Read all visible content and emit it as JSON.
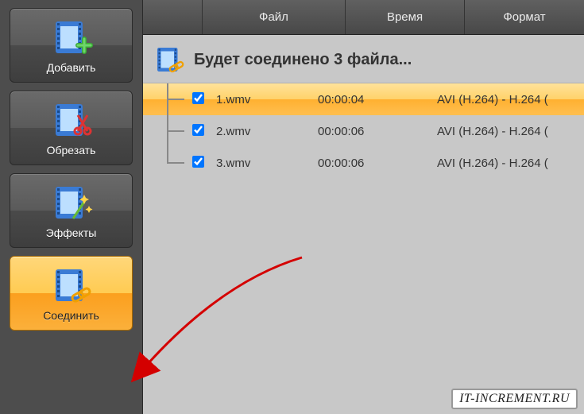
{
  "sidebar": {
    "items": [
      {
        "label": "Добавить"
      },
      {
        "label": "Обрезать"
      },
      {
        "label": "Эффекты"
      },
      {
        "label": "Соединить"
      }
    ]
  },
  "header": {
    "file": "Файл",
    "time": "Время",
    "format": "Формат"
  },
  "group": {
    "title": "Будет соединено 3 файла..."
  },
  "files": [
    {
      "name": "1.wmv",
      "time": "00:00:04",
      "format": "AVI (H.264) - H.264 (",
      "checked": true,
      "selected": true
    },
    {
      "name": "2.wmv",
      "time": "00:00:06",
      "format": "AVI (H.264) - H.264 (",
      "checked": true,
      "selected": false
    },
    {
      "name": "3.wmv",
      "time": "00:00:06",
      "format": "AVI (H.264) - H.264 (",
      "checked": true,
      "selected": false
    }
  ],
  "watermark": "IT-INCREMENT.RU"
}
